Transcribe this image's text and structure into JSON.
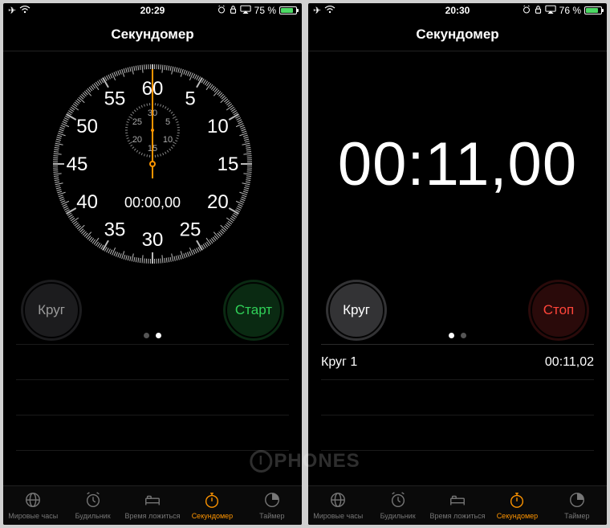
{
  "watermark": "PHONES",
  "screens": [
    {
      "status": {
        "time": "20:29",
        "battery_pct": "75 %",
        "airplane": true,
        "wifi": true,
        "alarm": true,
        "lock": true,
        "airplay": true
      },
      "title": "Секундомер",
      "mode": "analog",
      "elapsed": "00:00,00",
      "dial_numbers": [
        "60",
        "5",
        "10",
        "15",
        "20",
        "25",
        "30",
        "35",
        "40",
        "45",
        "50",
        "55"
      ],
      "subdial_numbers": [
        "30",
        "5",
        "10",
        "15",
        "20",
        "25"
      ],
      "left_btn": {
        "label": "Круг",
        "style": "gray"
      },
      "right_btn": {
        "label": "Старт",
        "style": "green"
      },
      "page_active": 1,
      "laps": [],
      "tabs": [
        {
          "label": "Мировые часы",
          "icon": "globe",
          "active": false
        },
        {
          "label": "Будильник",
          "icon": "alarm",
          "active": false
        },
        {
          "label": "Время ложиться",
          "icon": "bed",
          "active": false
        },
        {
          "label": "Секундомер",
          "icon": "stopwatch",
          "active": true
        },
        {
          "label": "Таймер",
          "icon": "timer",
          "active": false
        }
      ]
    },
    {
      "status": {
        "time": "20:30",
        "battery_pct": "76 %",
        "airplane": true,
        "wifi": true,
        "alarm": true,
        "lock": true,
        "airplay": true
      },
      "title": "Секундомер",
      "mode": "digital",
      "elapsed": "00:11,00",
      "left_btn": {
        "label": "Круг",
        "style": "gray-active"
      },
      "right_btn": {
        "label": "Стоп",
        "style": "red"
      },
      "page_active": 0,
      "laps": [
        {
          "name": "Круг 1",
          "time": "00:11,02"
        }
      ],
      "tabs": [
        {
          "label": "Мировые часы",
          "icon": "globe",
          "active": false
        },
        {
          "label": "Будильник",
          "icon": "alarm",
          "active": false
        },
        {
          "label": "Время ложиться",
          "icon": "bed",
          "active": false
        },
        {
          "label": "Секундомер",
          "icon": "stopwatch",
          "active": true
        },
        {
          "label": "Таймер",
          "icon": "timer",
          "active": false
        }
      ]
    }
  ]
}
